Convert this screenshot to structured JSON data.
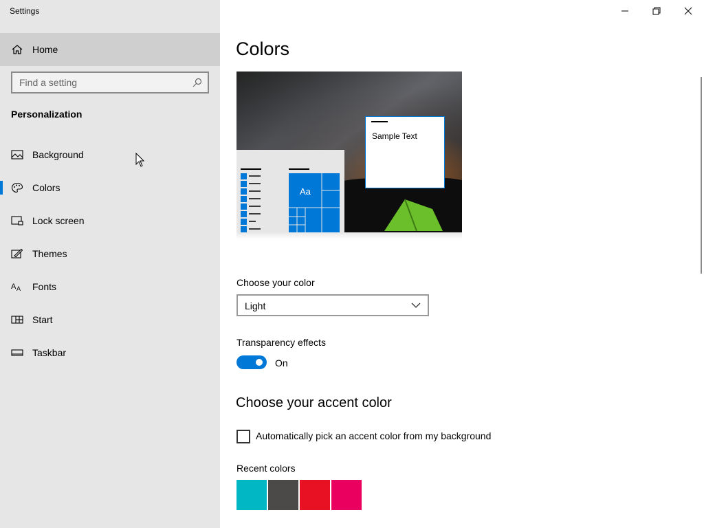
{
  "window": {
    "title": "Settings"
  },
  "sidebar": {
    "home_label": "Home",
    "search_placeholder": "Find a setting",
    "section_title": "Personalization",
    "items": [
      {
        "label": "Background",
        "icon": "picture-icon"
      },
      {
        "label": "Colors",
        "icon": "palette-icon",
        "selected": true
      },
      {
        "label": "Lock screen",
        "icon": "lock-screen-icon"
      },
      {
        "label": "Themes",
        "icon": "brush-icon"
      },
      {
        "label": "Fonts",
        "icon": "font-icon"
      },
      {
        "label": "Start",
        "icon": "start-icon"
      },
      {
        "label": "Taskbar",
        "icon": "taskbar-icon"
      }
    ]
  },
  "main": {
    "page_title": "Colors",
    "preview": {
      "sample_text": "Sample Text",
      "tile_text": "Aa"
    },
    "choose_color": {
      "label": "Choose your color",
      "value": "Light"
    },
    "transparency": {
      "label": "Transparency effects",
      "state": "On"
    },
    "accent": {
      "heading": "Choose your accent color",
      "auto_pick_label": "Automatically pick an accent color from my background",
      "recent_label": "Recent colors",
      "recent_colors": [
        "#00b7c3",
        "#4c4a48",
        "#e81123",
        "#ea005e"
      ]
    }
  },
  "colors": {
    "accent": "#0078d7",
    "sidebar_bg": "#e6e6e6"
  }
}
